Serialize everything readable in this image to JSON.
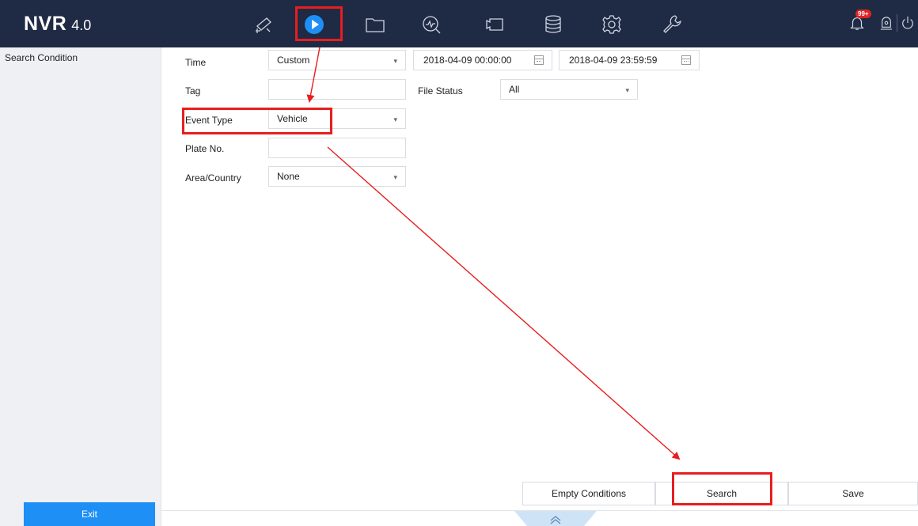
{
  "app": {
    "logo_brand": "NVR",
    "logo_version": "4.0",
    "notification_count": "99+"
  },
  "nav": {
    "icons": [
      "camera-icon",
      "playback-icon",
      "folder-icon",
      "search-chart-icon",
      "video-camera-icon",
      "storage-icon",
      "settings-gear-icon",
      "wrench-icon"
    ],
    "active": "playback-icon",
    "right_icons": [
      "bell-icon",
      "alarm-icon",
      "power-icon"
    ]
  },
  "sidebar": {
    "title": "Search Condition",
    "exit_label": "Exit"
  },
  "form": {
    "time_label": "Time",
    "time_value": "Custom",
    "start_datetime": "2018-04-09 00:00:00",
    "end_datetime": "2018-04-09 23:59:59",
    "tag_label": "Tag",
    "tag_value": "",
    "file_status_label": "File Status",
    "file_status_value": "All",
    "event_type_label": "Event Type",
    "event_type_value": "Vehicle",
    "plate_label": "Plate No.",
    "plate_value": "",
    "area_label": "Area/Country",
    "area_value": "None"
  },
  "actions": {
    "empty_label": "Empty Conditions",
    "search_label": "Search",
    "save_label": "Save"
  },
  "colors": {
    "topbar": "#1f2a44",
    "accent_blue": "#1e8ff5",
    "annotation_red": "#e81e1e"
  }
}
